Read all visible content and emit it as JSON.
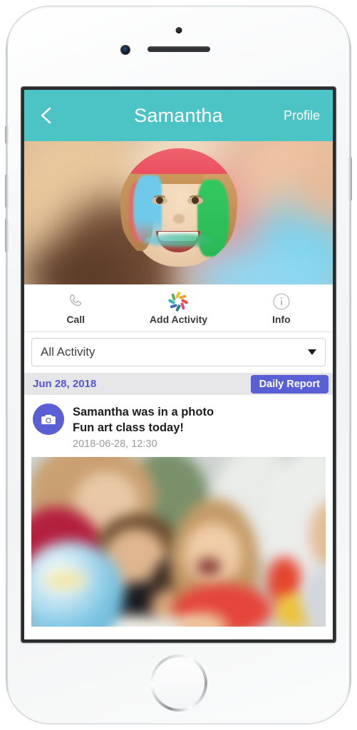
{
  "device": {
    "type": "smartphone-mockup",
    "color": "#f5f6f7"
  },
  "app": {
    "header": {
      "back_icon": "chevron-left-icon",
      "title": "Samantha",
      "action_label": "Profile",
      "background_color": "#4cc3c4",
      "text_color": "#ffffff"
    },
    "hero": {
      "avatar_alt": "Smiling child with blue and green face paint",
      "background_alt": "Blurred classroom background"
    },
    "actions": [
      {
        "icon": "phone-icon",
        "label": "Call"
      },
      {
        "icon": "activity-pinwheel-icon",
        "label": "Add Activity"
      },
      {
        "icon": "info-circle-icon",
        "label": "Info"
      }
    ],
    "pinwheel_colors": [
      "#f0c330",
      "#f2a23c",
      "#e8503f",
      "#e8467f",
      "#2f7f7a",
      "#3f6fbf",
      "#35b3b8",
      "#5bb05a"
    ],
    "filter": {
      "selected": "All Activity",
      "caret_icon": "chevron-down-icon"
    },
    "date_bar": {
      "date": "Jun 28, 2018",
      "report_button": "Daily Report",
      "date_color": "#5357cf",
      "button_color": "#5b5fd6",
      "background_color": "#e6e6e8"
    },
    "activity": {
      "icon": "camera-icon",
      "icon_background": "#5b5fd6",
      "title": "Samantha was in a photo",
      "caption": "Fun art class today!",
      "timestamp": "2018-06-28, 12:30",
      "photo_alt": "Children looking at a globe in a classroom"
    }
  }
}
